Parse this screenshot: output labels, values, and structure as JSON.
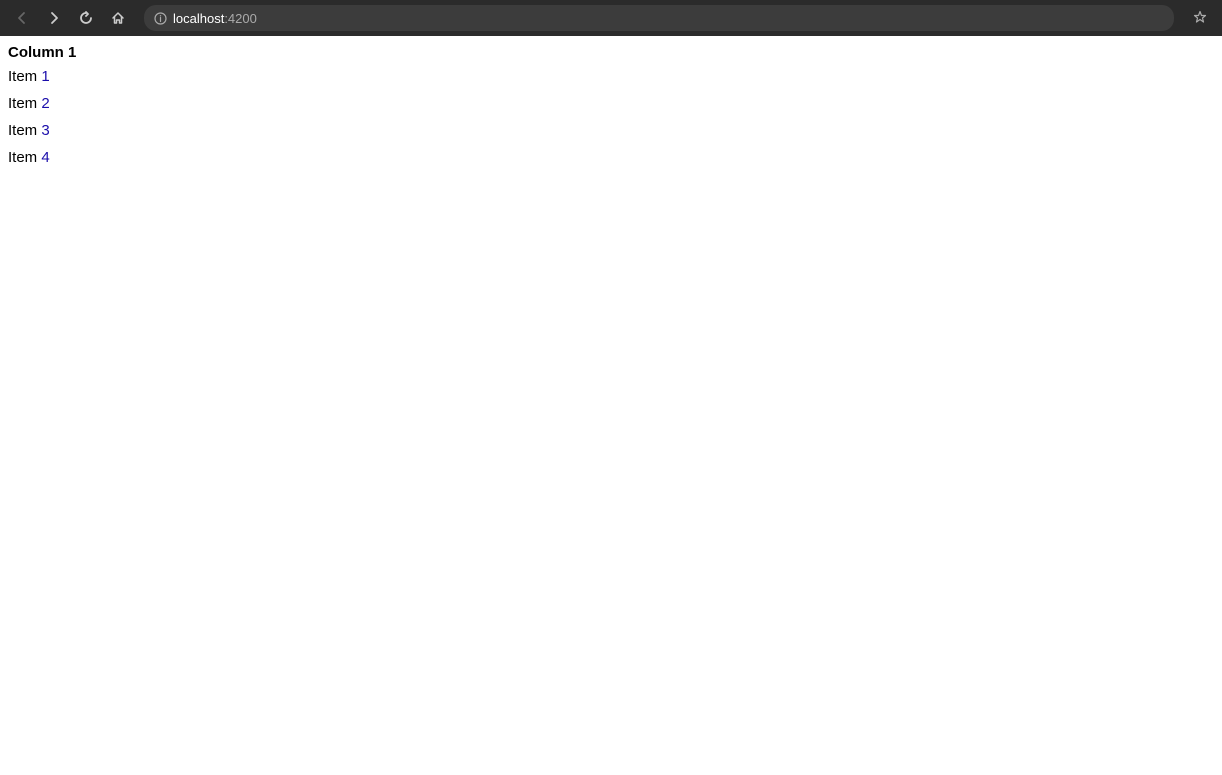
{
  "browser": {
    "url_host": "localhost",
    "url_port": ":4200",
    "url_full": "localhost:4200",
    "back_label": "←",
    "forward_label": "→",
    "reload_label": "↻",
    "home_label": "⌂",
    "bookmark_label": "☆"
  },
  "page": {
    "column_heading": "Column 1",
    "items": [
      {
        "label": "Item",
        "number": "1"
      },
      {
        "label": "Item",
        "number": "2"
      },
      {
        "label": "Item",
        "number": "3"
      },
      {
        "label": "Item",
        "number": "4"
      }
    ]
  }
}
